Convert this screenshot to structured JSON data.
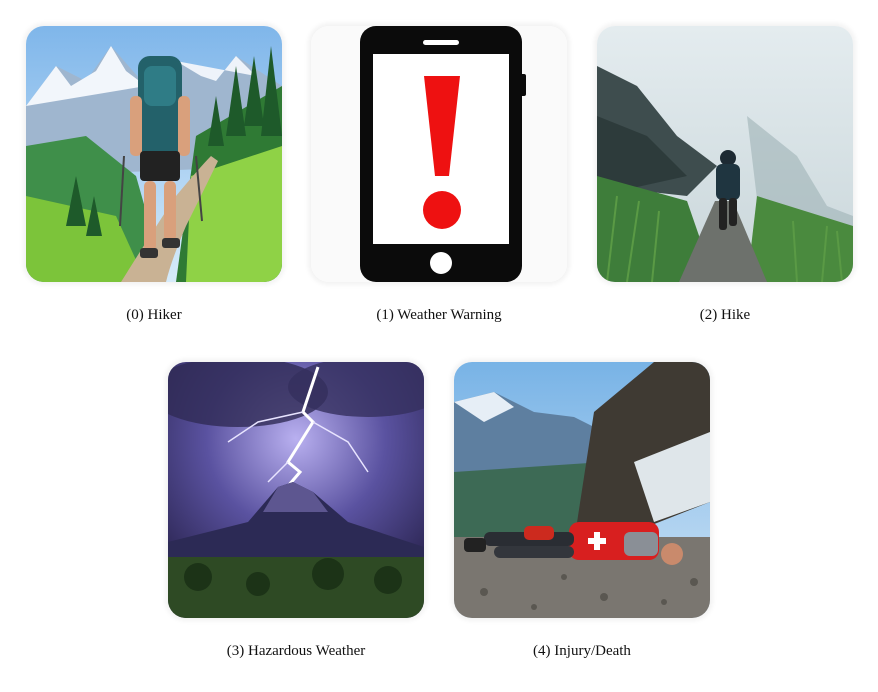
{
  "panels": [
    {
      "label": "(0) Hiker"
    },
    {
      "label": "(1) Weather Warning"
    },
    {
      "label": "(2) Hike"
    },
    {
      "label": "(3) Hazardous Weather"
    },
    {
      "label": "(4) Injury/Death"
    }
  ],
  "colors": {
    "warning_red": "#ee1111",
    "phone_body": "#0b0b0b",
    "sky_blue": "#8fc4ee",
    "storm_purple": "#3a3470",
    "grass_green": "#7cc43a"
  },
  "icons": [
    "hiker-photo",
    "phone-warning-icon",
    "misty-trail-photo",
    "lightning-volcano-photo",
    "injured-hiker-photo"
  ]
}
